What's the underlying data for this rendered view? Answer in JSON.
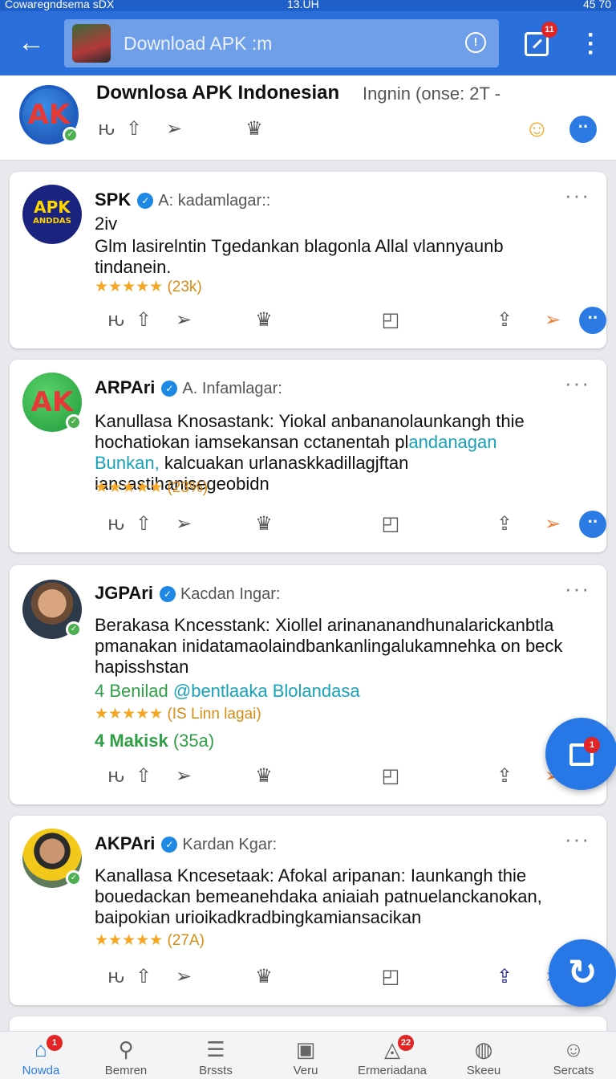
{
  "status_bar": {
    "left": "Cowaregndsema sDX",
    "time": "13.UH",
    "right": "45 70"
  },
  "app_bar": {
    "search_text": "Download APK :m",
    "notif_count": "11"
  },
  "header": {
    "title": "Downlosa APK Indonesian",
    "subtitle": "Ingnin (onse: 2T -"
  },
  "posts": [
    {
      "name": "SPK",
      "handle": "A: kadamlagar::",
      "extra": "2iv",
      "body": "Glm lasirelntin Tgedankan blagonla Allal vlannyaunb tindanein.",
      "rating": "★★★★★",
      "count": "(23k)",
      "avatar_text": "APK",
      "avatar_sub": "ANDDAS"
    },
    {
      "name": "ARPAri",
      "handle": "A. Infamlagar:",
      "body_a": "Kanullasa Knosastank: Yiokal anbananolaunkangh thie hochatiokan iamsekansan cctanentah pl",
      "body_teal": "andanagan Bunkan,",
      "body_b": "kalcuakan urlanaskkadillagjftan iansastihanisegeobidn",
      "rating": "★★★★★",
      "count": "(23%)",
      "avatar_text": "AK"
    },
    {
      "name": "JGPAri",
      "handle": "Kacdan Ingar:",
      "body": "Berakasa Kncesstank: Xiollel arinananandhunalarickanbtla pmanakan inidatamaolaindbankanlingalukamnehka on beck hapisshstan",
      "line_green": "4 Benilad",
      "line_teal": "@bentlaaka Blolandasa",
      "rating": "★★★★★",
      "count": "(IS Linn lagai)",
      "line2": "4 Makisk",
      "line2_count": "(35a)"
    },
    {
      "name": "AKPAri",
      "handle": "Kardan Kgar:",
      "body": "Kanallasa Kncesetaak: Afokal aripanan: Iaunkangh thie bouedackan bemeanehdaka aniaiah patnuelanckanokan, baipokian urioikadkradbingkamiansacikan",
      "rating": "★★★★★",
      "count": "(27A)"
    }
  ],
  "fab": {
    "badge": "1"
  },
  "bottom_nav": [
    {
      "label": "Nowda",
      "badge": "1",
      "icon": "home-icon"
    },
    {
      "label": "Bemren",
      "icon": "search-icon"
    },
    {
      "label": "Brssts",
      "icon": "list-icon"
    },
    {
      "label": "Veru",
      "icon": "square-icon"
    },
    {
      "label": "Ermeriadana",
      "badge": "22",
      "icon": "bell-icon"
    },
    {
      "label": "Skeeu",
      "icon": "explore-icon"
    },
    {
      "label": "Sercats",
      "icon": "profile-icon"
    }
  ]
}
